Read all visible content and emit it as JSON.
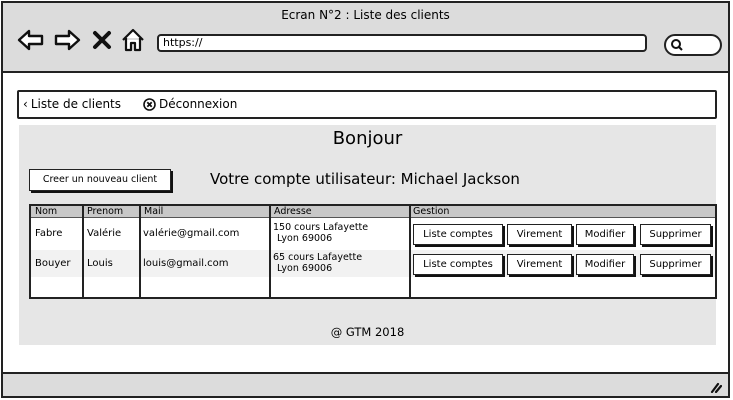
{
  "window": {
    "title": "Ecran N°2 : Liste des clients"
  },
  "browser": {
    "url": "https://",
    "icons": [
      "back-arrow-icon",
      "forward-arrow-icon",
      "close-x-icon",
      "home-icon",
      "search-icon"
    ]
  },
  "menu": {
    "back_label": "Liste de clients",
    "logout_label": "Déconnexion"
  },
  "main": {
    "greeting": "Bonjour",
    "create_button": "Creer un nouveau client",
    "account_line": "Votre compte utilisateur: Michael Jackson"
  },
  "table": {
    "headers": [
      "Nom",
      "Prenom",
      "Mail",
      "Adresse",
      "Gestion"
    ],
    "rows": [
      {
        "nom": "Fabre",
        "prenom": "Valérie",
        "mail": "valérie@gmail.com",
        "adresse_1": "150 cours Lafayette",
        "adresse_2": "Lyon  69006"
      },
      {
        "nom": "Bouyer",
        "prenom": "Louis",
        "mail": "louis@gmail.com",
        "adresse_1": "65 cours Lafayette",
        "adresse_2": "Lyon 69006"
      }
    ],
    "actions": [
      "Liste comptes",
      "Virement",
      "Modifier",
      "Supprimer"
    ]
  },
  "footer": {
    "text": "@ GTM 2018"
  },
  "colors": {
    "chrome": "#dcdcdc",
    "panel": "#e6e6e6",
    "header_row": "#c8c8c8",
    "border": "#222222"
  }
}
